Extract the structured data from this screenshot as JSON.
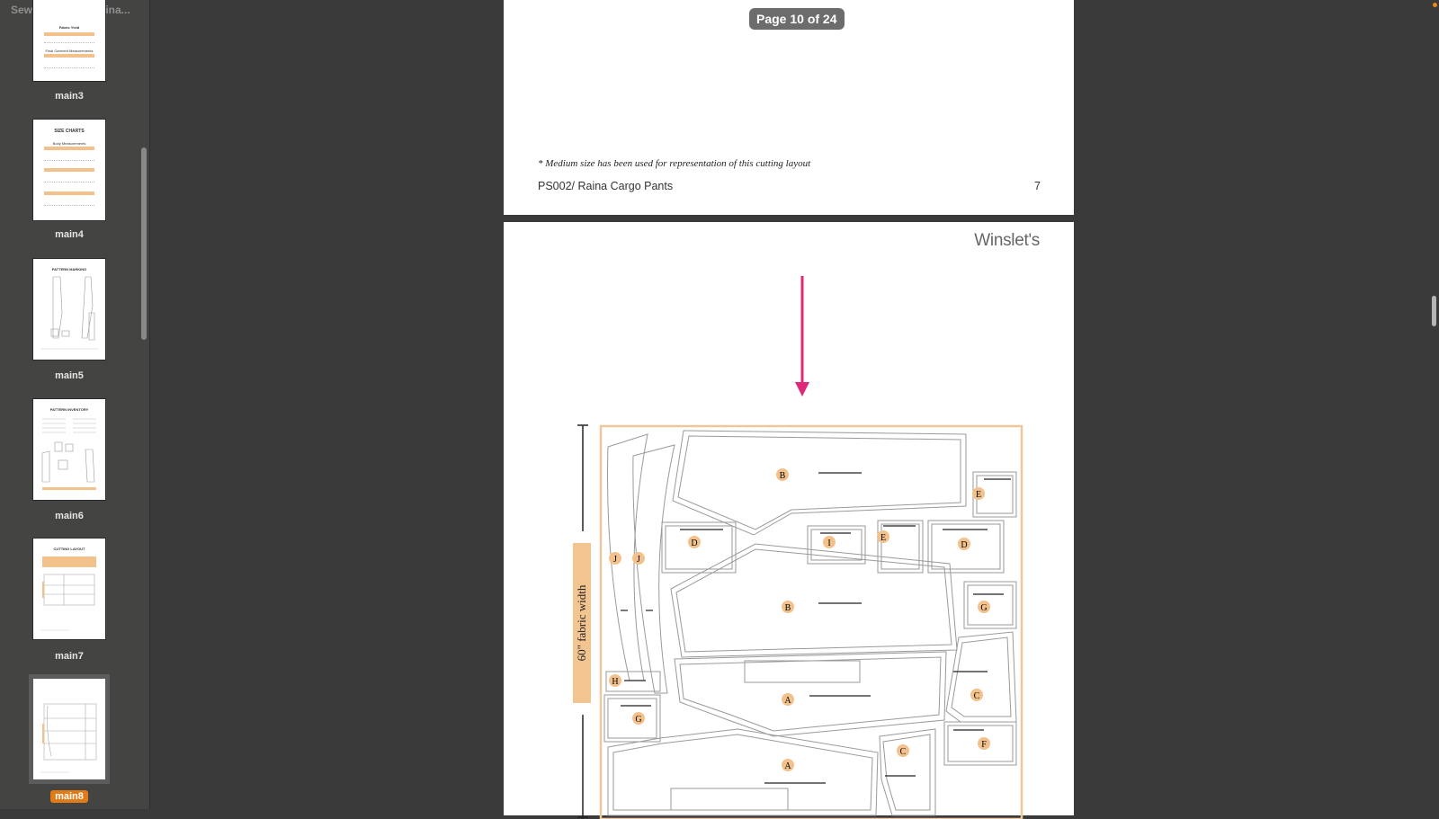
{
  "sidebar": {
    "title": "Sewing Guide - Raina...",
    "thumbnails": [
      {
        "label": "main3",
        "heading": "Fabric Yield",
        "sub": "Final Garment Measurements"
      },
      {
        "label": "main4",
        "heading": "SIZE CHARTS",
        "sub": "Body Measurements"
      },
      {
        "label": "main5",
        "heading": "PATTERN MARKING"
      },
      {
        "label": "main6",
        "heading": "PATTERN INVENTORY"
      },
      {
        "label": "main7",
        "heading": "CUTTING LAYOUT"
      },
      {
        "label": "main8"
      }
    ],
    "selected": "main8"
  },
  "viewer": {
    "page_indicator": "Page 10 of 24",
    "page_prev": {
      "note": "* Medium size has been used for representation of this cutting layout",
      "footer_left": "PS002/ Raina Cargo Pants",
      "footer_right": "7"
    },
    "page_current": {
      "brand": "Winslet's",
      "fabric_label": "60\" fabric width",
      "piece_labels": [
        "B",
        "E",
        "D",
        "I",
        "E",
        "D",
        "J",
        "J",
        "B",
        "G",
        "H",
        "A",
        "C",
        "G",
        "A",
        "C",
        "F"
      ],
      "arrow_color": "#e0287a",
      "fabric_band_color": "#f2c490",
      "label_circle_color": "#f3c28c"
    }
  }
}
